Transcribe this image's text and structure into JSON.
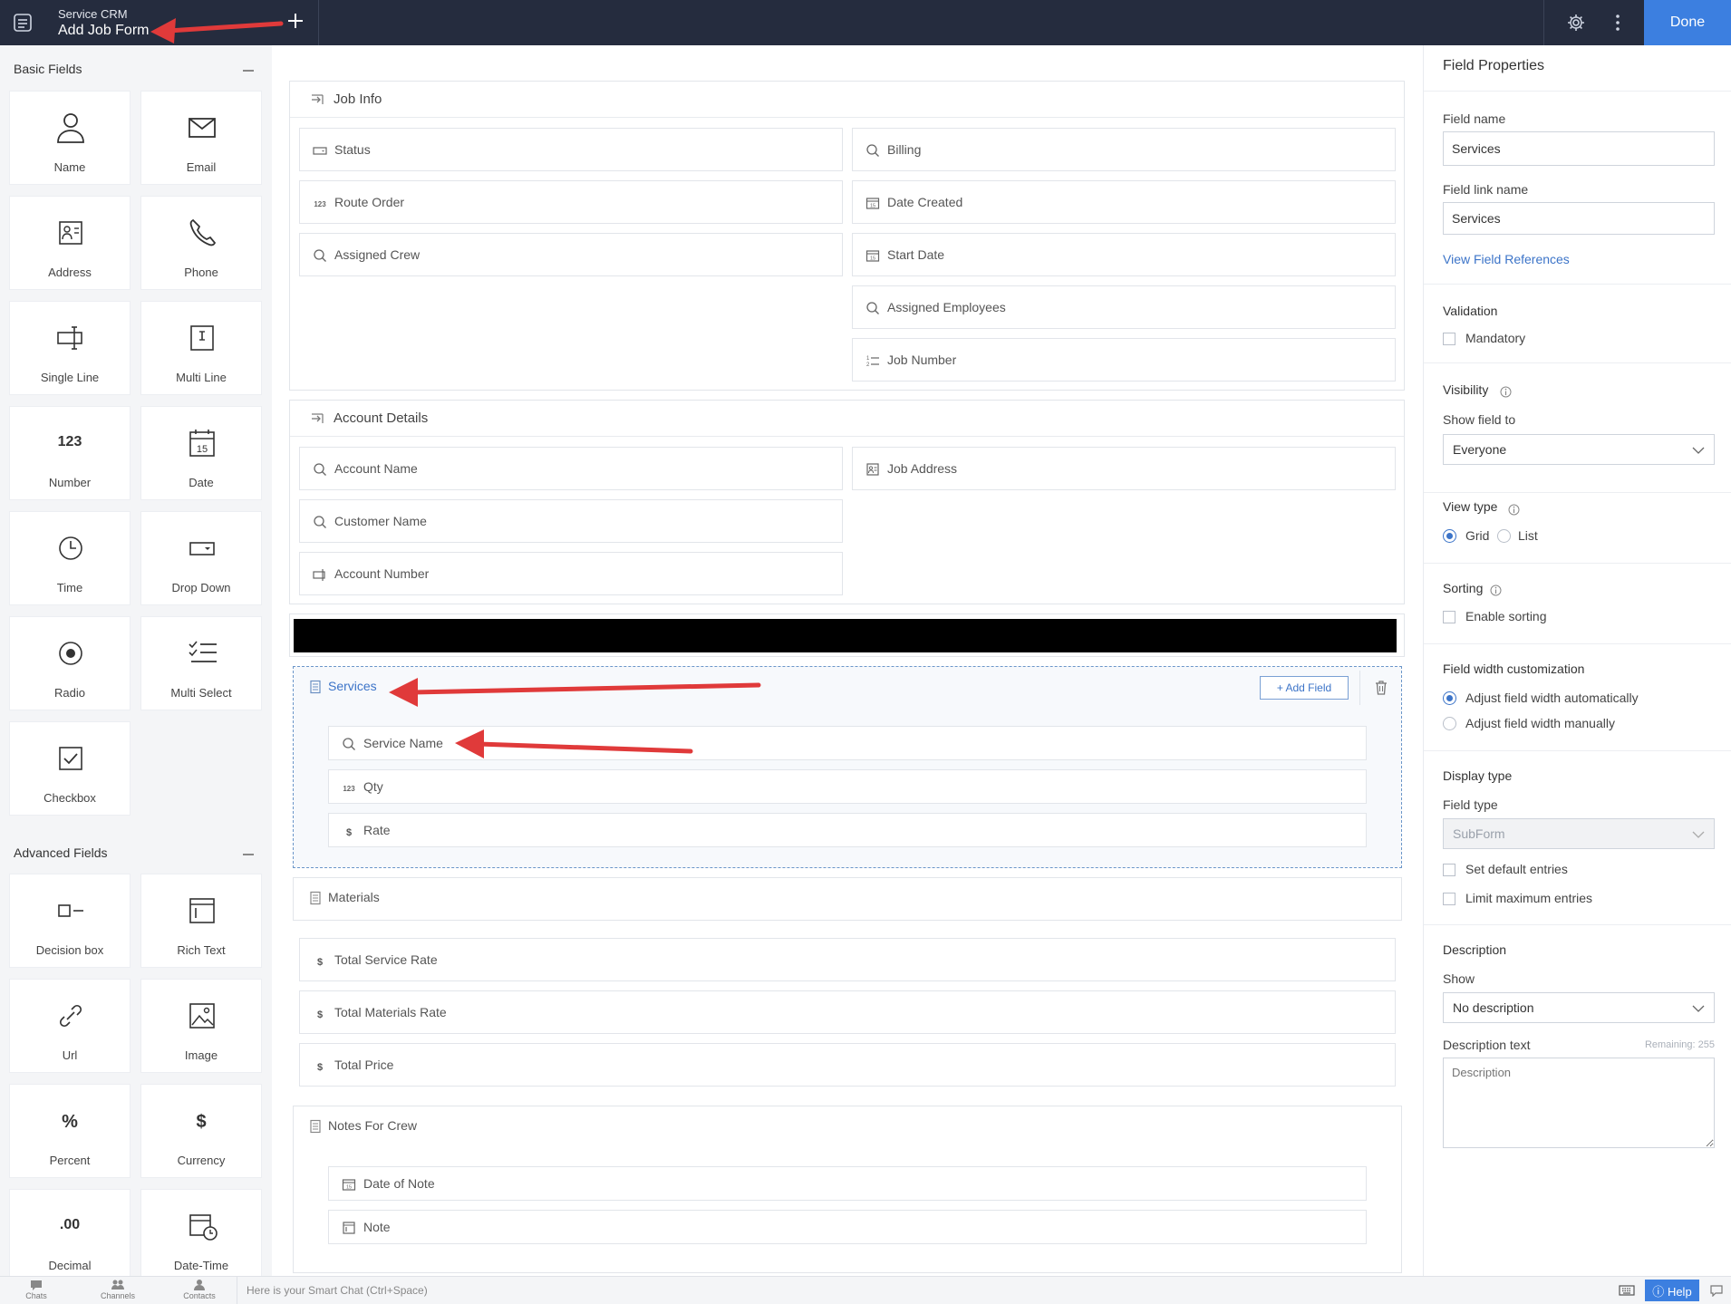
{
  "topbar": {
    "app_name": "Service CRM",
    "form_name": "Add Job Form",
    "done_label": "Done"
  },
  "left_panel": {
    "basic_title": "Basic Fields",
    "basic_fields": [
      {
        "label": "Name",
        "icon": "person-icon"
      },
      {
        "label": "Email",
        "icon": "envelope-icon"
      },
      {
        "label": "Address",
        "icon": "address-card-icon"
      },
      {
        "label": "Phone",
        "icon": "phone-icon"
      },
      {
        "label": "Single Line",
        "icon": "single-line-icon"
      },
      {
        "label": "Multi Line",
        "icon": "multi-line-icon"
      },
      {
        "label": "Number",
        "icon": "number-icon",
        "glyph": "123"
      },
      {
        "label": "Date",
        "icon": "calendar-icon"
      },
      {
        "label": "Time",
        "icon": "clock-icon"
      },
      {
        "label": "Drop Down",
        "icon": "dropdown-icon"
      },
      {
        "label": "Radio",
        "icon": "radio-icon"
      },
      {
        "label": "Multi Select",
        "icon": "multi-select-icon"
      },
      {
        "label": "Checkbox",
        "icon": "checkbox-icon"
      }
    ],
    "advanced_title": "Advanced Fields",
    "advanced_fields": [
      {
        "label": "Decision box",
        "icon": "decision-box-icon"
      },
      {
        "label": "Rich Text",
        "icon": "rich-text-icon"
      },
      {
        "label": "Url",
        "icon": "link-icon"
      },
      {
        "label": "Image",
        "icon": "image-icon"
      },
      {
        "label": "Percent",
        "icon": "percent-icon",
        "glyph": "%"
      },
      {
        "label": "Currency",
        "icon": "currency-icon",
        "glyph": "$"
      },
      {
        "label": "Decimal",
        "icon": "decimal-icon",
        "glyph": ".00"
      },
      {
        "label": "Date-Time",
        "icon": "date-time-icon"
      }
    ]
  },
  "form": {
    "job_info": {
      "title": "Job Info",
      "left": [
        {
          "label": "Status",
          "icon": "dropdown-icon"
        },
        {
          "label": "Route Order",
          "icon": "number-icon"
        },
        {
          "label": "Assigned Crew",
          "icon": "search-icon"
        }
      ],
      "right": [
        {
          "label": "Billing",
          "icon": "search-icon"
        },
        {
          "label": "Date Created",
          "icon": "calendar-icon"
        },
        {
          "label": "Start Date",
          "icon": "calendar-icon"
        },
        {
          "label": "Assigned Employees",
          "icon": "search-icon"
        },
        {
          "label": "Job Number",
          "icon": "auto-number-icon"
        }
      ]
    },
    "account_details": {
      "title": "Account Details",
      "left": [
        {
          "label": "Account Name",
          "icon": "search-icon"
        },
        {
          "label": "Customer Name",
          "icon": "search-icon"
        },
        {
          "label": "Account Number",
          "icon": "single-line-icon"
        }
      ],
      "right": [
        {
          "label": "Job Address",
          "icon": "address-card-icon"
        }
      ]
    },
    "services": {
      "title": "Services",
      "add_field_label": "+ Add Field",
      "rows": [
        {
          "label": "Service Name",
          "icon": "search-icon"
        },
        {
          "label": "Qty",
          "icon": "number-icon"
        },
        {
          "label": "Rate",
          "icon": "currency-icon"
        }
      ]
    },
    "materials": {
      "title": "Materials"
    },
    "totals": [
      {
        "label": "Total Service Rate",
        "icon": "currency-icon"
      },
      {
        "label": "Total Materials Rate",
        "icon": "currency-icon"
      },
      {
        "label": "Total Price",
        "icon": "currency-icon"
      }
    ],
    "notes": {
      "title": "Notes For Crew",
      "rows": [
        {
          "label": "Date of Note",
          "icon": "calendar-icon"
        },
        {
          "label": "Note",
          "icon": "rich-text-icon"
        }
      ]
    }
  },
  "properties": {
    "title": "Field Properties",
    "field_name_label": "Field name",
    "field_name_value": "Services",
    "field_link_label": "Field link name",
    "field_link_value": "Services",
    "view_refs_label": "View Field References",
    "validation_title": "Validation",
    "mandatory_label": "Mandatory",
    "visibility_title": "Visibility",
    "show_field_label": "Show field to",
    "show_field_value": "Everyone",
    "view_type_title": "View type",
    "view_type_options": [
      "Grid",
      "List"
    ],
    "view_type_selected": "Grid",
    "sorting_title": "Sorting",
    "enable_sorting_label": "Enable sorting",
    "width_title": "Field width customization",
    "width_options": [
      "Adjust field width automatically",
      "Adjust field width manually"
    ],
    "width_selected": "Adjust field width automatically",
    "display_title": "Display type",
    "field_type_label": "Field type",
    "field_type_value": "SubForm",
    "default_entries_label": "Set default entries",
    "limit_entries_label": "Limit maximum entries",
    "description_title": "Description",
    "show_label": "Show",
    "show_value": "No description",
    "desc_text_label": "Description text",
    "remaining_label": "Remaining: 255",
    "desc_placeholder": "Description"
  },
  "bottombar": {
    "items": [
      "Chats",
      "Channels",
      "Contacts"
    ],
    "chat_placeholder": "Here is your Smart Chat (Ctrl+Space)",
    "help_label": "Help"
  },
  "colors": {
    "topbar": "#252c3e",
    "accent": "#3c7fe0",
    "annotation_arrow": "#e03a3a"
  }
}
